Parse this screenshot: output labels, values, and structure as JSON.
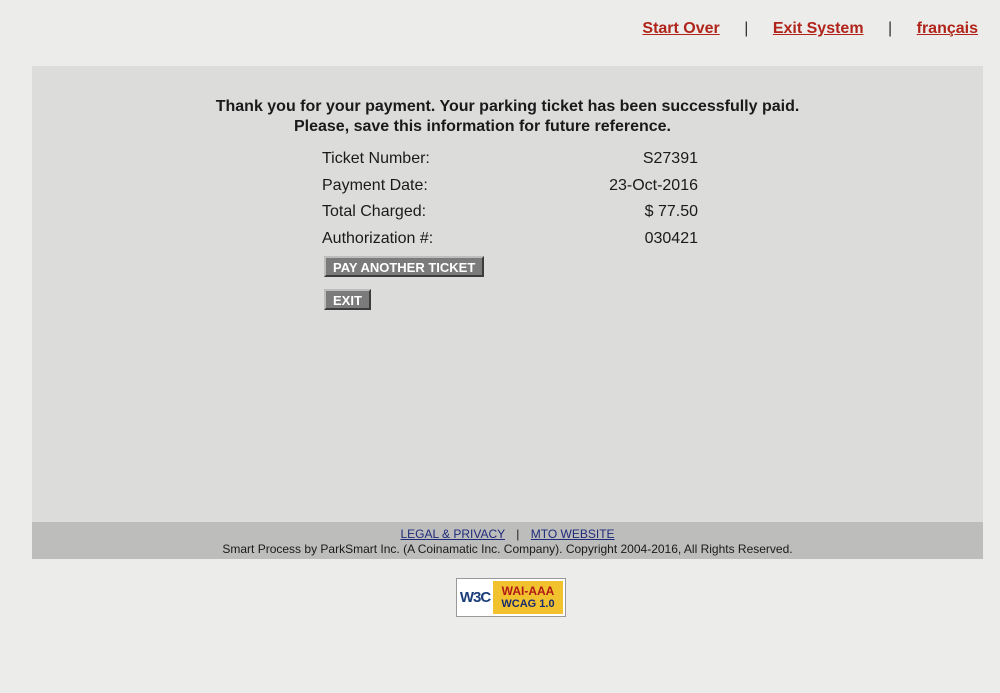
{
  "nav": {
    "start_over": "Start Over",
    "separator": "|",
    "exit_system": "Exit System",
    "language": "français"
  },
  "message": {
    "line1": "Thank you for your payment. Your parking ticket has been successfully paid.",
    "line2": "Please, save this information for future reference."
  },
  "details": [
    {
      "label": "Ticket Number:",
      "value": "S27391"
    },
    {
      "label": "Payment Date:",
      "value": "23-Oct-2016"
    },
    {
      "label": "Total Charged:",
      "value": "$ 77.50"
    },
    {
      "label": "Authorization #:",
      "value": "030421"
    }
  ],
  "buttons": {
    "pay_another": "PAY ANOTHER TICKET",
    "exit": "EXIT"
  },
  "footer": {
    "legal": "LEGAL & PRIVACY",
    "separator": "|",
    "mto": "MTO WEBSITE",
    "copyright": "Smart Process by ParkSmart Inc. (A Coinamatic Inc. Company). Copyright 2004-2016, All Rights Reserved."
  },
  "badge": {
    "w3c": "W3C",
    "level": "WAI-AAA",
    "standard": "WCAG 1.0"
  }
}
